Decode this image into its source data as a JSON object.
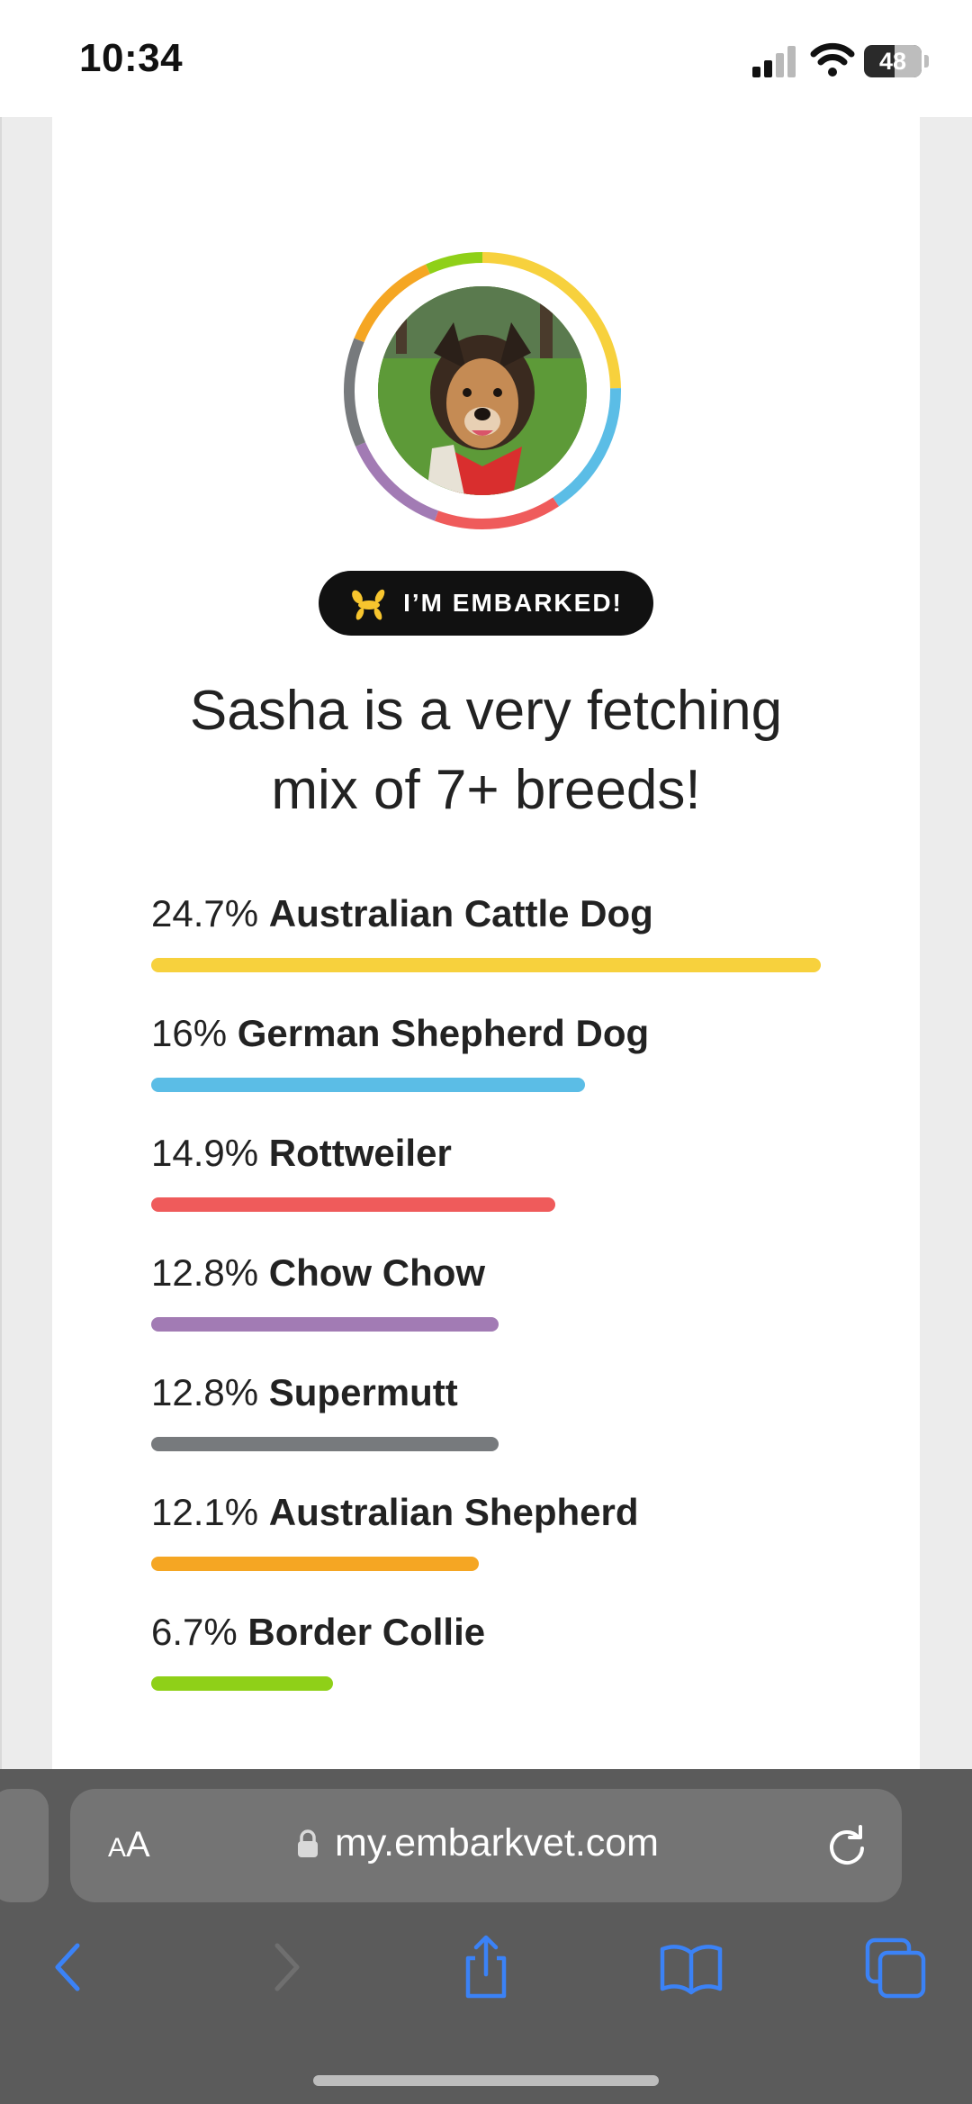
{
  "status_bar": {
    "time": "10:34",
    "battery": "48",
    "icons": [
      "cellular-signal-icon",
      "wifi-icon",
      "battery-icon"
    ]
  },
  "profile": {
    "ring_colors": [
      "#f7d13d",
      "#5bbde6",
      "#ef5b5b",
      "#a27bb4",
      "#777a7d",
      "#f5a623",
      "#8fd018"
    ],
    "photo_desc_icon": "dog-photo"
  },
  "badge": {
    "label": "I’M EMBARKED!",
    "icon": "balloon-dog-icon",
    "icon_color": "#f7c52e"
  },
  "headline": {
    "line1": "Sasha is a very fetching",
    "line2": "mix of 7+ breeds!"
  },
  "breeds": [
    {
      "pct": "24.7%",
      "name": "Australian Cattle Dog",
      "value": 24.7,
      "color": "#f7d13d"
    },
    {
      "pct": "16%",
      "name": "German Shepherd Dog",
      "value": 16.0,
      "color": "#5bbde6"
    },
    {
      "pct": "14.9%",
      "name": "Rottweiler",
      "value": 14.9,
      "color": "#ef5b5b"
    },
    {
      "pct": "12.8%",
      "name": "Chow Chow",
      "value": 12.8,
      "color": "#a27bb4"
    },
    {
      "pct": "12.8%",
      "name": "Supermutt",
      "value": 12.8,
      "color": "#777a7d"
    },
    {
      "pct": "12.1%",
      "name": "Australian Shepherd",
      "value": 12.1,
      "color": "#f5a623"
    },
    {
      "pct": "6.7%",
      "name": "Border Collie",
      "value": 6.7,
      "color": "#8fd018"
    }
  ],
  "browser": {
    "text_size_label": "AA",
    "url": "my.embarkvet.com",
    "toolbar_icons": [
      "back-icon",
      "forward-icon",
      "share-icon",
      "bookmarks-icon",
      "tabs-icon"
    ],
    "accent": "#3b82f6"
  }
}
